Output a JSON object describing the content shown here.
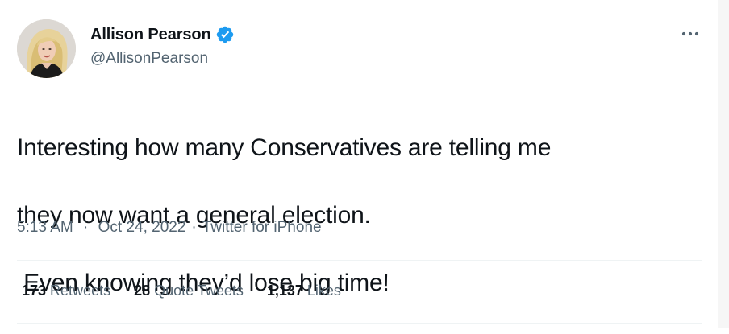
{
  "author": {
    "display_name": "Allison Pearson",
    "handle": "@AllisonPearson",
    "verified": true,
    "avatar_icon": "profile-photo",
    "verified_icon": "verified-badge-icon"
  },
  "tweet": {
    "text_lines": [
      "Interesting how many Conservatives are telling me",
      "they now want a general election.",
      " Even knowing they’d lose big time!"
    ],
    "time": "5:13 AM",
    "date": "Oct 24, 2022",
    "source": "Twitter for iPhone",
    "separator": "·"
  },
  "stats": {
    "retweets_count": "173",
    "retweets_label": "Retweets",
    "quote_count": "28",
    "quote_label": "Quote Tweets",
    "likes_count": "1,137",
    "likes_label": "Likes"
  },
  "colors": {
    "text_primary": "#0f1419",
    "text_secondary": "#536471",
    "verified_blue": "#1d9bf0",
    "divider": "#eff3f4"
  }
}
